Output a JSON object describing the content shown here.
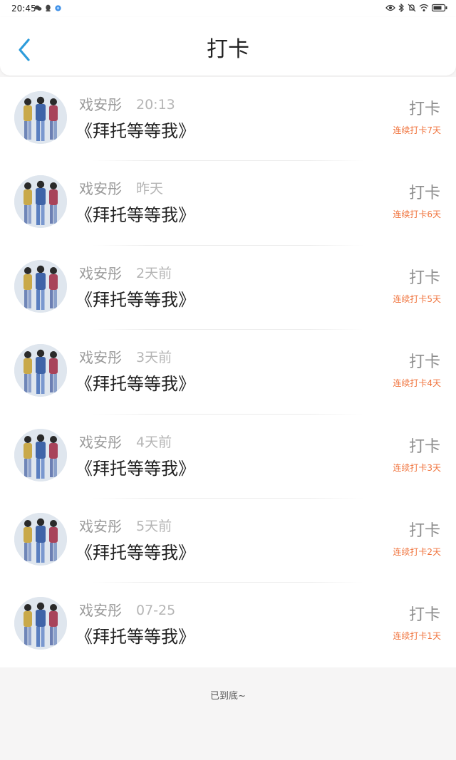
{
  "status_bar": {
    "time": "20:45",
    "icons_left": [
      "wechat-icon",
      "qq-icon",
      "app-icon"
    ],
    "icons_right": [
      "eye-icon",
      "bluetooth-icon",
      "mute-icon",
      "wifi-icon",
      "battery-icon"
    ]
  },
  "header": {
    "title": "打卡",
    "back_icon": "chevron-left-icon",
    "accent": "#2d9cdb"
  },
  "items": [
    {
      "name": "戏安彤",
      "time": "20:13",
      "text": "《拜托等等我》",
      "action": "打卡",
      "streak": "连续打卡7天"
    },
    {
      "name": "戏安彤",
      "time": "昨天",
      "text": "《拜托等等我》",
      "action": "打卡",
      "streak": "连续打卡6天"
    },
    {
      "name": "戏安彤",
      "time": "2天前",
      "text": "《拜托等等我》",
      "action": "打卡",
      "streak": "连续打卡5天"
    },
    {
      "name": "戏安彤",
      "time": "3天前",
      "text": "《拜托等等我》",
      "action": "打卡",
      "streak": "连续打卡4天"
    },
    {
      "name": "戏安彤",
      "time": "4天前",
      "text": "《拜托等等我》",
      "action": "打卡",
      "streak": "连续打卡3天"
    },
    {
      "name": "戏安彤",
      "time": "5天前",
      "text": "《拜托等等我》",
      "action": "打卡",
      "streak": "连续打卡2天"
    },
    {
      "name": "戏安彤",
      "time": "07-25",
      "text": "《拜托等等我》",
      "action": "打卡",
      "streak": "连续打卡1天"
    }
  ],
  "footer": {
    "end_text": "已到底~"
  },
  "colors": {
    "streak": "#f0733c",
    "background": "#f6f5f5"
  }
}
